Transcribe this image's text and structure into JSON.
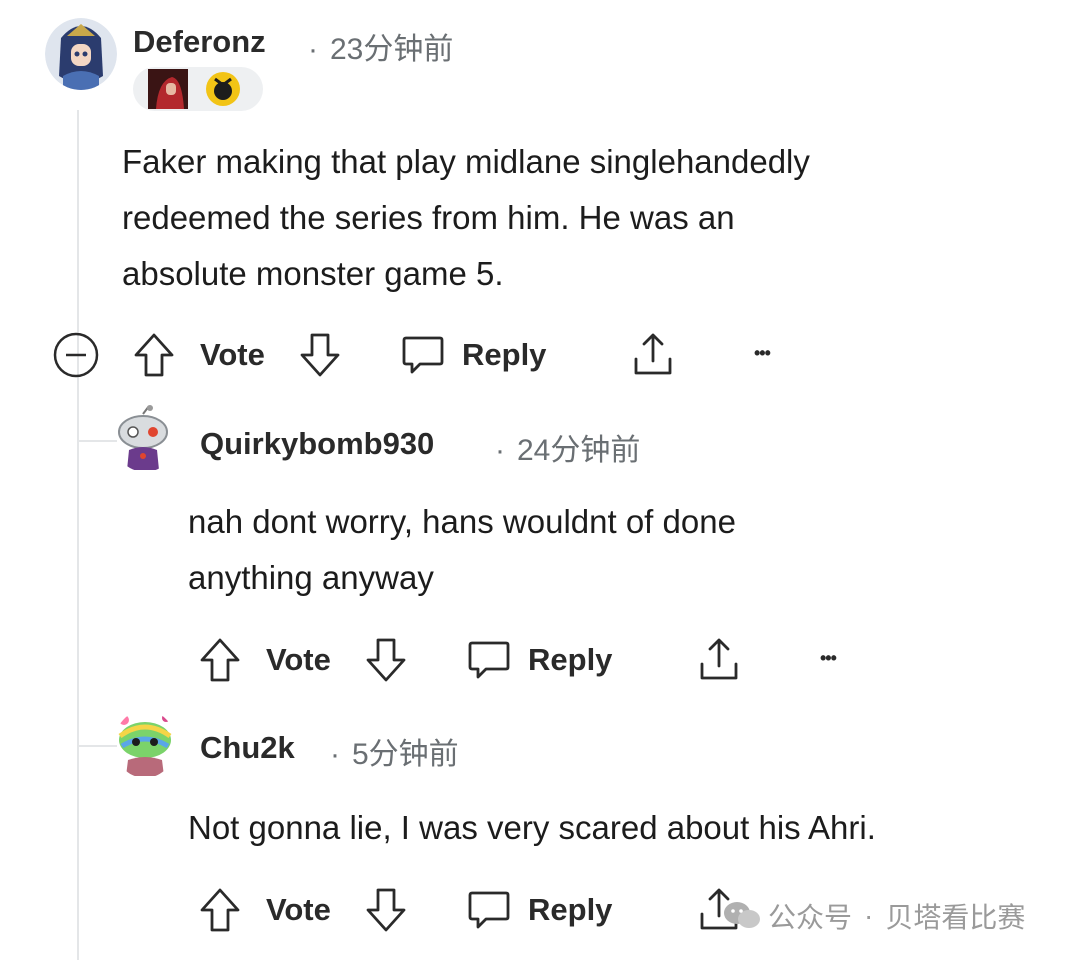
{
  "comments": [
    {
      "username": "Deferonz",
      "time": "23分钟前",
      "text_lines": [
        "Faker making that play midlane singlehandedly",
        "redeemed the series from him. He was an",
        "absolute monster game 5."
      ],
      "actions": {
        "vote": "Vote",
        "reply": "Reply",
        "more": "•••"
      },
      "avatar_icon": "blue-haired-champion-avatar",
      "flair_icons": [
        "red-champion-portrait-icon",
        "yellow-team-logo-icon"
      ]
    },
    {
      "username": "Quirkybomb930",
      "time": "24分钟前",
      "text_lines": [
        "nah dont worry, hans wouldnt of done",
        "anything anyway"
      ],
      "actions": {
        "vote": "Vote",
        "reply": "Reply",
        "more": "•••"
      },
      "avatar_icon": "snoo-robot-avatar"
    },
    {
      "username": "Chu2k",
      "time": "5分钟前",
      "text_lines": [
        "Not gonna lie, I was very scared about his Ahri."
      ],
      "actions": {
        "vote": "Vote",
        "reply": "Reply"
      },
      "avatar_icon": "rainbow-snoo-avatar"
    }
  ],
  "separator_dot": "·",
  "watermark": {
    "account_label": "公众号",
    "separator": "·",
    "name": "贝塔看比赛"
  },
  "colors": {
    "text": "#1c1c1c",
    "meta": "#6a6f73",
    "thread_line": "#e4e6e8",
    "icon_stroke": "#2a2a2a"
  }
}
